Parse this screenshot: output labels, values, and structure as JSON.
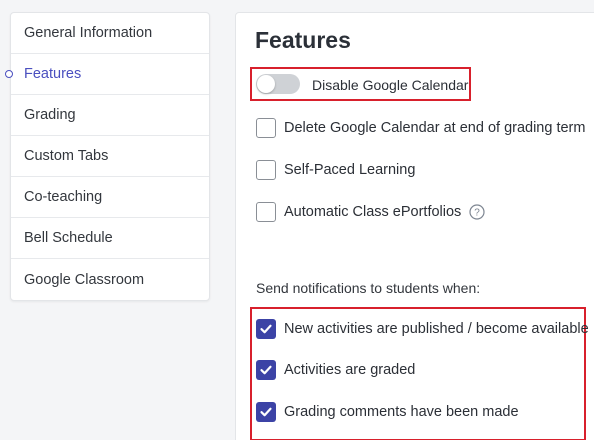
{
  "sidebar": {
    "items": [
      {
        "label": "General Information",
        "active": false
      },
      {
        "label": "Features",
        "active": true
      },
      {
        "label": "Grading",
        "active": false
      },
      {
        "label": "Custom Tabs",
        "active": false
      },
      {
        "label": "Co-teaching",
        "active": false
      },
      {
        "label": "Bell Schedule",
        "active": false
      },
      {
        "label": "Google Classroom",
        "active": false
      }
    ]
  },
  "main": {
    "title": "Features",
    "calendar_toggle": {
      "label": "Disable Google Calendar",
      "on": false
    },
    "options": [
      {
        "label": "Delete Google Calendar at end of grading term",
        "checked": false
      },
      {
        "label": "Self-Paced Learning",
        "checked": false
      },
      {
        "label": "Automatic Class ePortfolios",
        "checked": false,
        "help_icon": "question-circle-icon"
      }
    ],
    "notifications": {
      "label": "Send notifications to students when:",
      "options": [
        {
          "label": "New activities are published / become available",
          "checked": true
        },
        {
          "label": "Activities are graded",
          "checked": true
        },
        {
          "label": "Grading comments have been made",
          "checked": true
        }
      ]
    }
  },
  "colors": {
    "accent": "#3c43a6",
    "active_nav": "#4a4fbf",
    "highlight_box": "#d8202c",
    "toggle_off": "#cfd2d6"
  }
}
